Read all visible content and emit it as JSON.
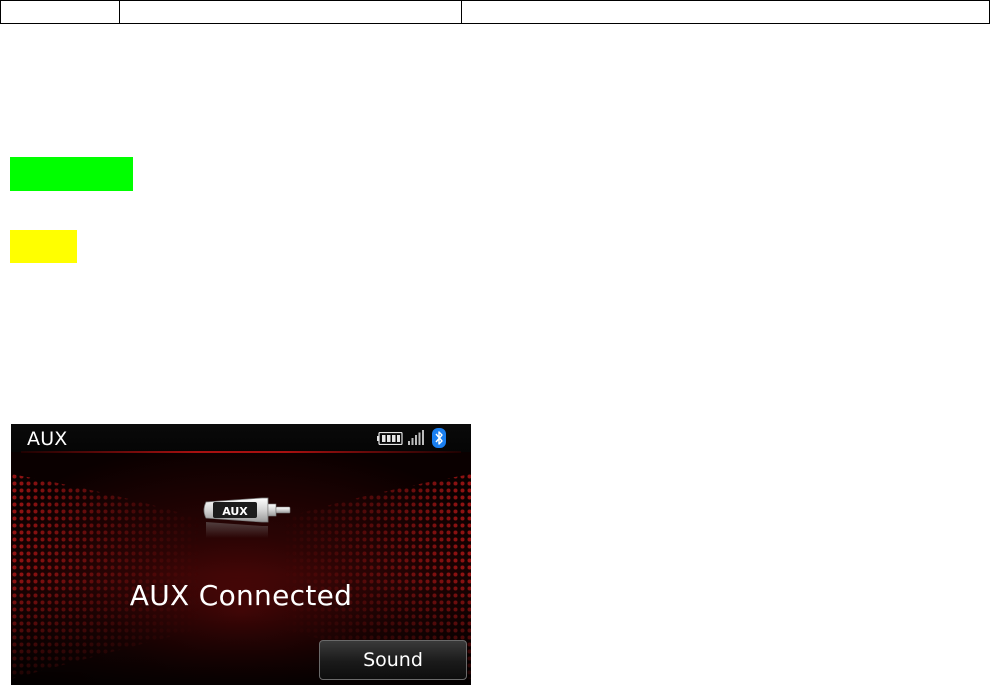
{
  "screen": {
    "title": "AUX",
    "status_icons": [
      "battery-icon",
      "signal-icon",
      "bluetooth-icon"
    ],
    "device_icon": "aux-plug-icon",
    "device_icon_label": "AUX",
    "message": "AUX Connected",
    "sound_button_label": "Sound"
  },
  "colors": {
    "swatch_green": "#00ff00",
    "swatch_yellow": "#ffff00",
    "accent_red": "#a81010",
    "bluetooth_blue": "#1a7ff0"
  }
}
